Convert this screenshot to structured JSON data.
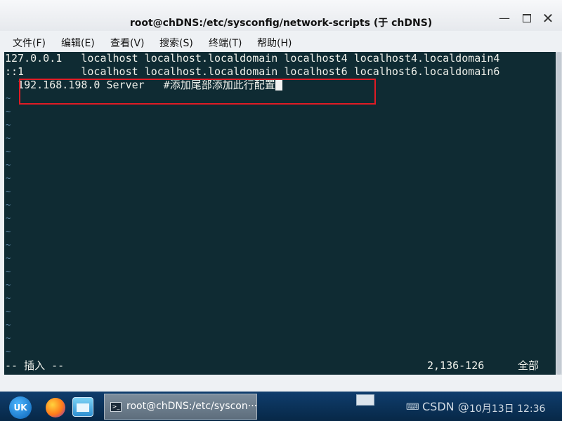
{
  "window": {
    "title": "root@chDNS:/etc/sysconfig/network-scripts (于 chDNS)",
    "minimize": "—",
    "close": "✕"
  },
  "menu": [
    "文件(F)",
    "编辑(E)",
    "查看(V)",
    "搜索(S)",
    "终端(T)",
    "帮助(H)"
  ],
  "terminal": {
    "lines": [
      "127.0.0.1   localhost localhost.localdomain localhost4 localhost4.localdomain4",
      "::1         localhost localhost.localdomain localhost6 localhost6.localdomain6",
      "  192.168.198.0 Server   #添加尾部添加此行配置"
    ],
    "tilde": "~",
    "status_mode": "-- 插入 --",
    "status_position": "2,136-126",
    "status_scope": "全部"
  },
  "taskbar": {
    "launcher": "UK",
    "task_label": "root@chDNS:/etc/syscon···",
    "task_icon": ">_",
    "tray_text": "CSDN @",
    "tray_clock": "10月13日 12:36"
  },
  "colors": {
    "terminal_bg": "#0f2b33",
    "tilde": "#5f89a8",
    "highlight": "#e01b24",
    "taskbar": "#0a3157"
  }
}
